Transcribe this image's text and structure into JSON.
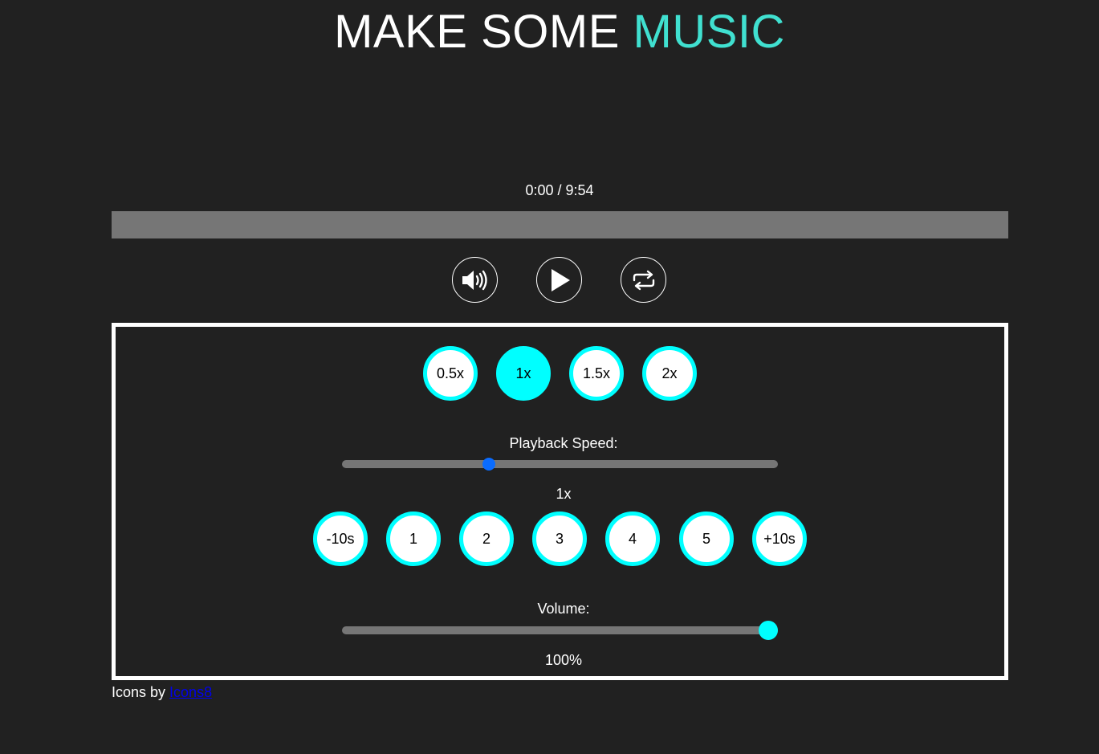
{
  "header": {
    "title_main": "MAKE SOME ",
    "title_accent": "MUSIC"
  },
  "player": {
    "time_display": "0:00 / 9:54",
    "progress_fraction": 0,
    "controls": {
      "mute_icon": "speaker-volume-icon",
      "play_icon": "play-icon",
      "loop_icon": "repeat-icon"
    }
  },
  "panel": {
    "speed_buttons": [
      "0.5x",
      "1x",
      "1.5x",
      "2x"
    ],
    "active_speed": "1x",
    "playback_speed": {
      "label": "Playback Speed:",
      "value_text": "1x",
      "fraction": 0.333
    },
    "seek_buttons": [
      "-10s",
      "1",
      "2",
      "3",
      "4",
      "5",
      "+10s"
    ],
    "volume": {
      "label": "Volume:",
      "value_text": "100%",
      "fraction": 1.0
    }
  },
  "footer": {
    "credit_text": "Icons by ",
    "credit_link": "Icons8"
  },
  "colors": {
    "background": "#212121",
    "accent": "#40e0d0",
    "cyan": "#00ffff",
    "speed_thumb": "#0a6cff",
    "track": "#767676"
  }
}
